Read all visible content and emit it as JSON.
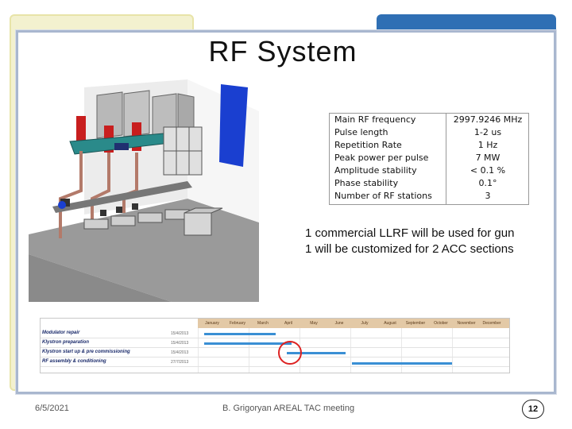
{
  "slide": {
    "title": "RF System"
  },
  "specs": [
    {
      "label": "Main RF frequency",
      "value": "2997.9246 MHz"
    },
    {
      "label": "Pulse length",
      "value": "1-2 us"
    },
    {
      "label": "Repetition Rate",
      "value": "1 Hz"
    },
    {
      "label": "Peak power per pulse",
      "value": "7 MW"
    },
    {
      "label": "Amplitude stability",
      "value": "< 0.1 %"
    },
    {
      "label": "Phase stability",
      "value": "0.1°"
    },
    {
      "label": "Number of RF stations",
      "value": "3"
    }
  ],
  "notes": {
    "line1": "1 commercial LLRF will be used for gun",
    "line2": "1 will be customized for 2 ACC sections"
  },
  "gantt": {
    "months": [
      "January",
      "February",
      "March",
      "April",
      "May",
      "June",
      "July",
      "August",
      "September",
      "October",
      "November",
      "December"
    ],
    "tasks": [
      {
        "name": "Modulator repair",
        "date": "15/4/2013"
      },
      {
        "name": "Klystron preparation",
        "date": "15/4/2013"
      },
      {
        "name": "Klystron start up & pre commissioning",
        "date": "15/4/2013"
      },
      {
        "name": "RF assembly & conditioning",
        "date": "27/7/2013"
      }
    ],
    "bar_color": "#3a8fd4",
    "highlight_color": "#dd2222"
  },
  "footer": {
    "date": "6/5/2021",
    "presenter": "B. Grigoryan AREAL TAC meeting",
    "page": "12"
  }
}
